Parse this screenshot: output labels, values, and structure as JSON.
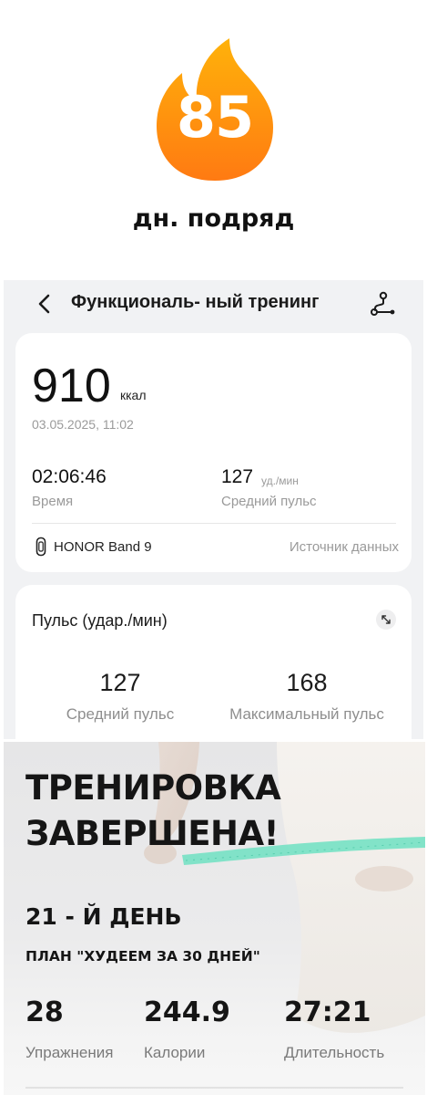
{
  "streak": {
    "days": "85",
    "caption": "дн. подряд",
    "colors": {
      "flame_top": "#ffb20a",
      "flame_bottom": "#ff7a12"
    }
  },
  "workout": {
    "header": {
      "back_icon": "chevron-left-icon",
      "title": "Функциональ- ный тренинг",
      "route_icon": "route-icon"
    },
    "summary": {
      "calories": "910",
      "calories_unit": "ккал",
      "date": "03.05.2025, 11:02",
      "duration": "02:06:46",
      "duration_label": "Время",
      "avg_hr": "127",
      "avg_hr_unit": "уд./мин",
      "avg_hr_label": "Средний пульс",
      "device_icon": "band-icon",
      "device": "HONOR Band 9",
      "source_label": "Источник данных"
    },
    "pulse": {
      "title": "Пульс (удар./мин)",
      "expand_icon": "expand-icon",
      "avg_value": "127",
      "avg_label": "Средний пульс",
      "max_value": "168",
      "max_label": "Максимальный пульс"
    }
  },
  "completion": {
    "title_line1": "ТРЕНИРОВКА",
    "title_line2": "ЗАВЕРШЕНА!",
    "day": "21 - Й ДЕНЬ",
    "plan": "ПЛАН \"ХУДЕЕМ ЗА 30 ДНЕЙ\"",
    "stats": [
      {
        "value": "28",
        "label": "Упражнения"
      },
      {
        "value": "244.9",
        "label": "Калории"
      },
      {
        "value": "27:21",
        "label": "Длительность"
      }
    ],
    "tape_color": "#6fe0c2"
  }
}
